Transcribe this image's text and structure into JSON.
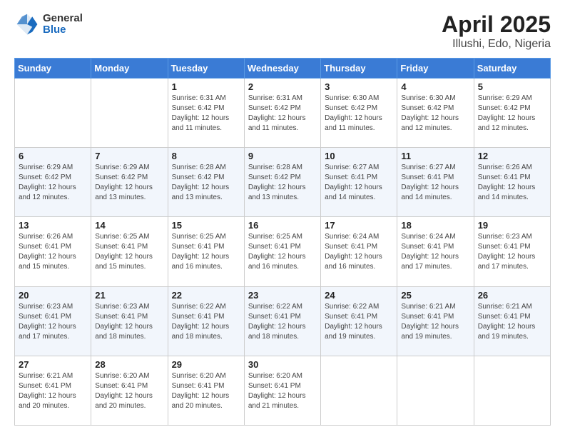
{
  "logo": {
    "general": "General",
    "blue": "Blue"
  },
  "title": "April 2025",
  "subtitle": "Illushi, Edo, Nigeria",
  "weekdays": [
    "Sunday",
    "Monday",
    "Tuesday",
    "Wednesday",
    "Thursday",
    "Friday",
    "Saturday"
  ],
  "weeks": [
    [
      null,
      null,
      {
        "day": 1,
        "sunrise": "6:31 AM",
        "sunset": "6:42 PM",
        "daylight": "12 hours and 11 minutes."
      },
      {
        "day": 2,
        "sunrise": "6:31 AM",
        "sunset": "6:42 PM",
        "daylight": "12 hours and 11 minutes."
      },
      {
        "day": 3,
        "sunrise": "6:30 AM",
        "sunset": "6:42 PM",
        "daylight": "12 hours and 11 minutes."
      },
      {
        "day": 4,
        "sunrise": "6:30 AM",
        "sunset": "6:42 PM",
        "daylight": "12 hours and 12 minutes."
      },
      {
        "day": 5,
        "sunrise": "6:29 AM",
        "sunset": "6:42 PM",
        "daylight": "12 hours and 12 minutes."
      }
    ],
    [
      {
        "day": 6,
        "sunrise": "6:29 AM",
        "sunset": "6:42 PM",
        "daylight": "12 hours and 12 minutes."
      },
      {
        "day": 7,
        "sunrise": "6:29 AM",
        "sunset": "6:42 PM",
        "daylight": "12 hours and 13 minutes."
      },
      {
        "day": 8,
        "sunrise": "6:28 AM",
        "sunset": "6:42 PM",
        "daylight": "12 hours and 13 minutes."
      },
      {
        "day": 9,
        "sunrise": "6:28 AM",
        "sunset": "6:42 PM",
        "daylight": "12 hours and 13 minutes."
      },
      {
        "day": 10,
        "sunrise": "6:27 AM",
        "sunset": "6:41 PM",
        "daylight": "12 hours and 14 minutes."
      },
      {
        "day": 11,
        "sunrise": "6:27 AM",
        "sunset": "6:41 PM",
        "daylight": "12 hours and 14 minutes."
      },
      {
        "day": 12,
        "sunrise": "6:26 AM",
        "sunset": "6:41 PM",
        "daylight": "12 hours and 14 minutes."
      }
    ],
    [
      {
        "day": 13,
        "sunrise": "6:26 AM",
        "sunset": "6:41 PM",
        "daylight": "12 hours and 15 minutes."
      },
      {
        "day": 14,
        "sunrise": "6:25 AM",
        "sunset": "6:41 PM",
        "daylight": "12 hours and 15 minutes."
      },
      {
        "day": 15,
        "sunrise": "6:25 AM",
        "sunset": "6:41 PM",
        "daylight": "12 hours and 16 minutes."
      },
      {
        "day": 16,
        "sunrise": "6:25 AM",
        "sunset": "6:41 PM",
        "daylight": "12 hours and 16 minutes."
      },
      {
        "day": 17,
        "sunrise": "6:24 AM",
        "sunset": "6:41 PM",
        "daylight": "12 hours and 16 minutes."
      },
      {
        "day": 18,
        "sunrise": "6:24 AM",
        "sunset": "6:41 PM",
        "daylight": "12 hours and 17 minutes."
      },
      {
        "day": 19,
        "sunrise": "6:23 AM",
        "sunset": "6:41 PM",
        "daylight": "12 hours and 17 minutes."
      }
    ],
    [
      {
        "day": 20,
        "sunrise": "6:23 AM",
        "sunset": "6:41 PM",
        "daylight": "12 hours and 17 minutes."
      },
      {
        "day": 21,
        "sunrise": "6:23 AM",
        "sunset": "6:41 PM",
        "daylight": "12 hours and 18 minutes."
      },
      {
        "day": 22,
        "sunrise": "6:22 AM",
        "sunset": "6:41 PM",
        "daylight": "12 hours and 18 minutes."
      },
      {
        "day": 23,
        "sunrise": "6:22 AM",
        "sunset": "6:41 PM",
        "daylight": "12 hours and 18 minutes."
      },
      {
        "day": 24,
        "sunrise": "6:22 AM",
        "sunset": "6:41 PM",
        "daylight": "12 hours and 19 minutes."
      },
      {
        "day": 25,
        "sunrise": "6:21 AM",
        "sunset": "6:41 PM",
        "daylight": "12 hours and 19 minutes."
      },
      {
        "day": 26,
        "sunrise": "6:21 AM",
        "sunset": "6:41 PM",
        "daylight": "12 hours and 19 minutes."
      }
    ],
    [
      {
        "day": 27,
        "sunrise": "6:21 AM",
        "sunset": "6:41 PM",
        "daylight": "12 hours and 20 minutes."
      },
      {
        "day": 28,
        "sunrise": "6:20 AM",
        "sunset": "6:41 PM",
        "daylight": "12 hours and 20 minutes."
      },
      {
        "day": 29,
        "sunrise": "6:20 AM",
        "sunset": "6:41 PM",
        "daylight": "12 hours and 20 minutes."
      },
      {
        "day": 30,
        "sunrise": "6:20 AM",
        "sunset": "6:41 PM",
        "daylight": "12 hours and 21 minutes."
      },
      null,
      null,
      null
    ]
  ]
}
